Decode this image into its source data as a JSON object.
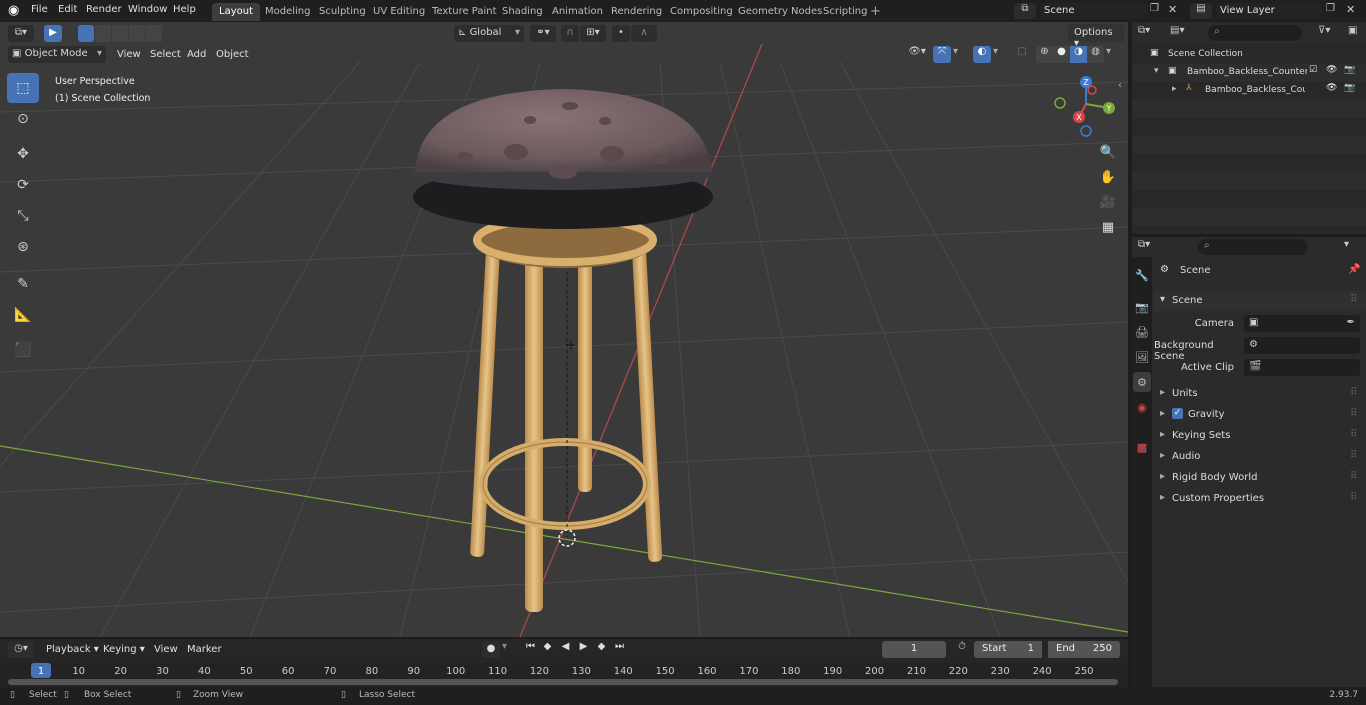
{
  "topbar": {
    "menus": [
      "File",
      "Edit",
      "Render",
      "Window",
      "Help"
    ],
    "workspaces": [
      "Layout",
      "Modeling",
      "Sculpting",
      "UV Editing",
      "Texture Paint",
      "Shading",
      "Animation",
      "Rendering",
      "Compositing",
      "Geometry Nodes",
      "Scripting"
    ],
    "active_workspace": "Layout",
    "scene_name": "Scene",
    "view_layer": "View Layer"
  },
  "viewport": {
    "mode": "Object Mode",
    "menus": [
      "View",
      "Select",
      "Add",
      "Object"
    ],
    "transform_orientation": "Global",
    "options_label": "Options",
    "perspective_label": "User Perspective",
    "collection_label": "(1) Scene Collection",
    "gizmo": {
      "x": "X",
      "y": "Y",
      "z": "Z"
    }
  },
  "outliner": {
    "root": "Scene Collection",
    "items": [
      "Bamboo_Backless_Counter_S",
      "Bamboo_Backless_Coun"
    ]
  },
  "properties": {
    "context": "Scene",
    "section": "Scene",
    "fields": [
      {
        "label": "Camera",
        "value": ""
      },
      {
        "label": "Background Scene",
        "value": ""
      },
      {
        "label": "Active Clip",
        "value": ""
      }
    ],
    "panels": [
      "Units",
      "Gravity",
      "Keying Sets",
      "Audio",
      "Rigid Body World",
      "Custom Properties"
    ]
  },
  "timeline": {
    "menus": [
      "Playback",
      "Keying",
      "View",
      "Marker"
    ],
    "current_frame": "1",
    "start_label": "Start",
    "start": "1",
    "end_label": "End",
    "end": "250",
    "ticks": [
      "1",
      "10",
      "20",
      "30",
      "40",
      "50",
      "60",
      "70",
      "80",
      "90",
      "100",
      "110",
      "120",
      "130",
      "140",
      "150",
      "160",
      "170",
      "180",
      "190",
      "200",
      "210",
      "220",
      "230",
      "240",
      "250"
    ]
  },
  "status": {
    "items": [
      "Select",
      "Box Select",
      "Zoom View",
      "Lasso Select"
    ],
    "version": "2.93.7"
  },
  "colors": {
    "accent": "#4772b3",
    "x_axis": "#b34a4a",
    "y_axis": "#7aa83a"
  }
}
